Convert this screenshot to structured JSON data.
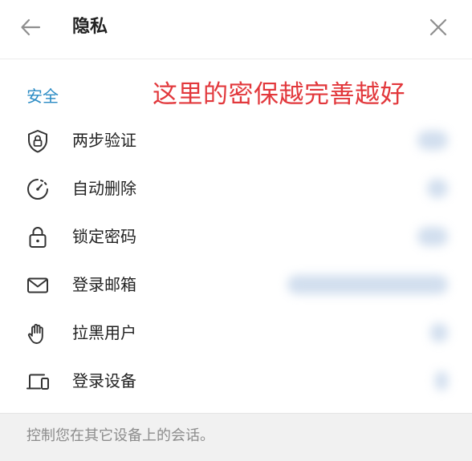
{
  "header": {
    "title": "隐私",
    "back_icon": "arrow-left-icon",
    "close_icon": "close-icon"
  },
  "section": {
    "title": "安全"
  },
  "annotation": {
    "text": "这里的密保越完善越好",
    "color": "#e2383c"
  },
  "items": [
    {
      "label": "两步验证",
      "icon": "shield-lock-icon"
    },
    {
      "label": "自动删除",
      "icon": "timer-icon"
    },
    {
      "label": "锁定密码",
      "icon": "lock-icon"
    },
    {
      "label": "登录邮箱",
      "icon": "mail-icon"
    },
    {
      "label": "拉黑用户",
      "icon": "hand-icon"
    },
    {
      "label": "登录设备",
      "icon": "devices-icon"
    }
  ],
  "footer": {
    "text": "控制您在其它设备上的会话。"
  },
  "colors": {
    "accent": "#2a8bc4",
    "annotation": "#e2383c",
    "footer_bg": "#f1f1f1"
  }
}
